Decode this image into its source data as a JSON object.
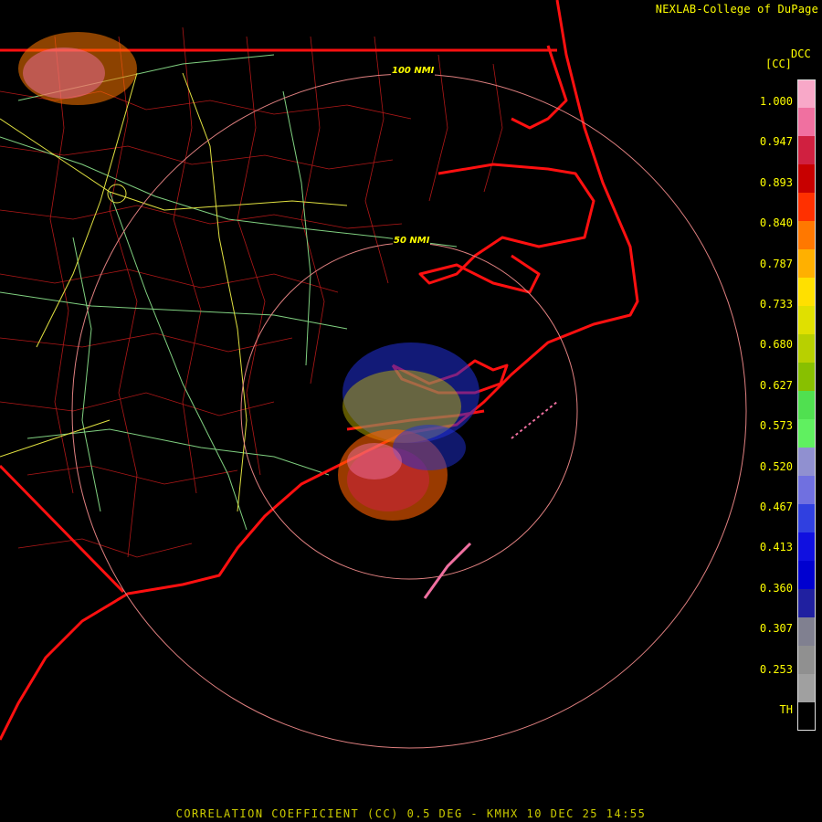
{
  "credit": "NEXLAB-College of DuPage",
  "product_tag": "DCC",
  "units": "[CC]",
  "range_rings": [
    "100 NMI",
    "50 NMI"
  ],
  "scale_labels": [
    "1.000",
    "0.947",
    "0.893",
    "0.840",
    "0.787",
    "0.733",
    "0.680",
    "0.627",
    "0.573",
    "0.520",
    "0.467",
    "0.413",
    "0.360",
    "0.307",
    "0.253",
    "TH"
  ],
  "scale_colors": [
    "#f8a8c8",
    "#f070a0",
    "#d02040",
    "#c80000",
    "#ff3000",
    "#ff7800",
    "#ffb000",
    "#ffe000",
    "#e0e000",
    "#b8d000",
    "#88c000",
    "#50e050",
    "#60f060",
    "#9090d0",
    "#7070e0",
    "#3040e0",
    "#1010e0",
    "#0000d0",
    "#2020a0",
    "#808090",
    "#909090",
    "#a0a0a0",
    "#000000"
  ],
  "footer": "CORRELATION COEFFICIENT (CC) 0.5 DEG - KMHX 10 DEC 25 14:55"
}
